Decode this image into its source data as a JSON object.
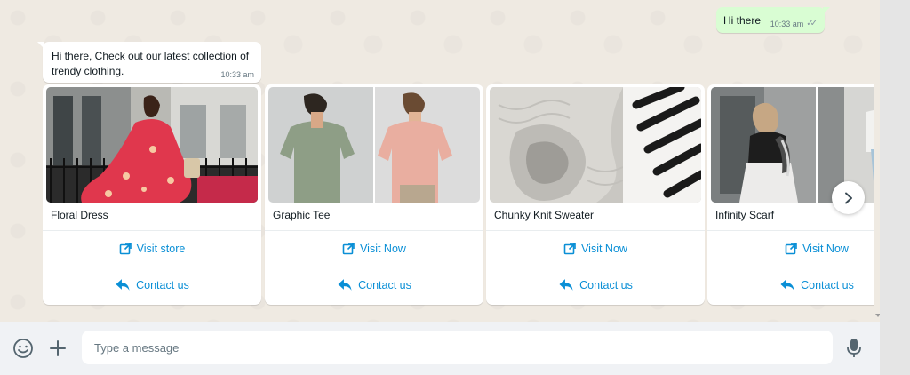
{
  "outgoing": {
    "text": "Hi there",
    "time": "10:33 am",
    "ticks": "✓✓"
  },
  "incoming": {
    "text": "Hi there, Check out our latest collection of trendy clothing.",
    "time": "10:33 am"
  },
  "cards": [
    {
      "title": "Floral Dress",
      "button1": "Visit store",
      "button2": "Contact us"
    },
    {
      "title": "Graphic Tee",
      "button1": "Visit Now",
      "button2": "Contact us"
    },
    {
      "title": "Chunky Knit Sweater",
      "button1": "Visit Now",
      "button2": "Contact us"
    },
    {
      "title": "Infinity Scarf",
      "button1": "Visit Now",
      "button2": "Contact us"
    }
  ],
  "composer": {
    "placeholder": "Type a message"
  },
  "icons": {
    "emoji": "emoji-icon",
    "attach": "plus-icon",
    "mic": "microphone-icon",
    "link": "external-link-icon",
    "reply": "reply-icon",
    "next": "chevron-right-icon"
  },
  "colors": {
    "accent": "#0a8fd6",
    "outgoing_bubble": "#d9fdd3",
    "chat_bg": "#efeae2"
  }
}
